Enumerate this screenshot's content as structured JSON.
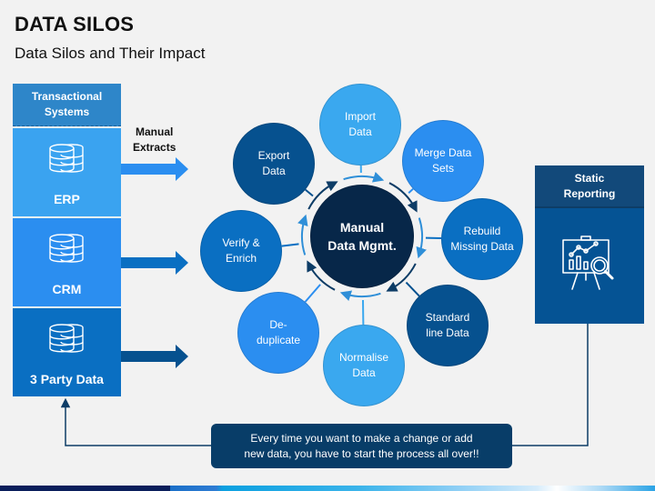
{
  "header": {
    "title": "DATA SILOS",
    "subtitle": "Data Silos and Their Impact"
  },
  "left_column": {
    "heading": "Transactional Systems",
    "heading_lines": [
      "Transactional",
      "Systems"
    ],
    "items": [
      {
        "label": "ERP",
        "icon": "database-icon",
        "color": "#3aa3f0"
      },
      {
        "label": "CRM",
        "icon": "database-icon",
        "color": "#2b8ef0"
      },
      {
        "label": "3 Party Data",
        "icon": "database-icon",
        "color": "#0a6fc2"
      }
    ]
  },
  "arrows_label": {
    "lines": [
      "Manual",
      "Extracts"
    ]
  },
  "arrow_colors": [
    "#2b8ef0",
    "#0a6fc2",
    "#06518f"
  ],
  "hub": {
    "lines": [
      "Manual",
      "Data Mgmt."
    ],
    "color": "#072749"
  },
  "steps": [
    {
      "id": "import-data",
      "lines": [
        "Import",
        "Data"
      ],
      "color": "#3aa8ef"
    },
    {
      "id": "merge-data-sets",
      "lines": [
        "Merge Data",
        "Sets"
      ],
      "color": "#2b8ef0"
    },
    {
      "id": "rebuild-missing-data",
      "lines": [
        "Rebuild",
        "Missing Data"
      ],
      "color": "#0a6fc2"
    },
    {
      "id": "standard-line-data",
      "lines": [
        "Standard",
        "line Data"
      ],
      "color": "#06518f"
    },
    {
      "id": "normalise-data",
      "lines": [
        "Normalise",
        "Data"
      ],
      "color": "#3aa8ef"
    },
    {
      "id": "de-duplicate",
      "lines": [
        "De-",
        "duplicate"
      ],
      "color": "#2b8ef0"
    },
    {
      "id": "verify-enrich",
      "lines": [
        "Verify &",
        "Enrich"
      ],
      "color": "#0a6fc2"
    },
    {
      "id": "export-data",
      "lines": [
        "Export",
        "Data"
      ],
      "color": "#06518f"
    }
  ],
  "right_column": {
    "heading_lines": [
      "Static",
      "Reporting"
    ],
    "icon": "presentation-analytics-icon"
  },
  "note": {
    "lines": [
      "Every time you want to make a change or add",
      "new data, you have to start the process all over!!"
    ]
  }
}
